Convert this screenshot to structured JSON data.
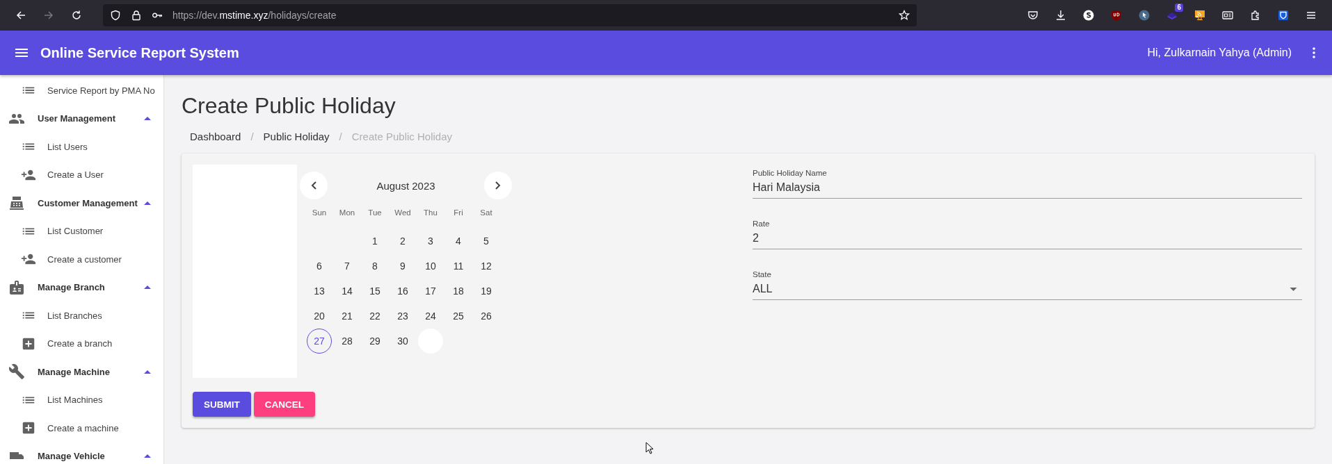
{
  "browser": {
    "url_prefix": "https://dev.",
    "url_domain": "mstime.xyz",
    "url_path": "/holidays/create",
    "extension_badge": "6",
    "forward_disabled": true
  },
  "app_bar": {
    "title": "Online Service Report System",
    "greeting": "Hi, Zulkarnain Yahya (Admin)"
  },
  "sidebar": {
    "items": [
      {
        "kind": "link",
        "label": "Service Report by PMA No"
      },
      {
        "kind": "group",
        "label": "User Management",
        "expanded": true
      },
      {
        "kind": "link",
        "label": "List Users"
      },
      {
        "kind": "link",
        "label": "Create a User"
      },
      {
        "kind": "group",
        "label": "Customer Management",
        "expanded": true
      },
      {
        "kind": "link",
        "label": "List Customer"
      },
      {
        "kind": "link",
        "label": "Create a customer"
      },
      {
        "kind": "group",
        "label": "Manage Branch",
        "expanded": true
      },
      {
        "kind": "link",
        "label": "List Branches"
      },
      {
        "kind": "link",
        "label": "Create a branch"
      },
      {
        "kind": "group",
        "label": "Manage Machine",
        "expanded": true
      },
      {
        "kind": "link",
        "label": "List Machines"
      },
      {
        "kind": "link",
        "label": "Create a machine"
      },
      {
        "kind": "group",
        "label": "Manage Vehicle",
        "expanded": true
      }
    ]
  },
  "page": {
    "title": "Create Public Holiday",
    "breadcrumb_separator": "/",
    "breadcrumbs": [
      {
        "label": "Dashboard",
        "disabled": false
      },
      {
        "label": "Public Holiday",
        "disabled": false
      },
      {
        "label": "Create Public Holiday",
        "disabled": true
      }
    ]
  },
  "calendar": {
    "month": "August 2023",
    "weekdays": [
      "Sun",
      "Mon",
      "Tue",
      "Wed",
      "Thu",
      "Fri",
      "Sat"
    ],
    "days": [
      {
        "kind": "empty"
      },
      {
        "kind": "empty"
      },
      {
        "kind": "day",
        "label": "1",
        "today": false
      },
      {
        "kind": "day",
        "label": "2",
        "today": false
      },
      {
        "kind": "day",
        "label": "3",
        "today": false
      },
      {
        "kind": "day",
        "label": "4",
        "today": false
      },
      {
        "kind": "day",
        "label": "5",
        "today": false
      },
      {
        "kind": "day",
        "label": "6",
        "today": false
      },
      {
        "kind": "day",
        "label": "7",
        "today": false
      },
      {
        "kind": "day",
        "label": "8",
        "today": false
      },
      {
        "kind": "day",
        "label": "9",
        "today": false
      },
      {
        "kind": "day",
        "label": "10",
        "today": false
      },
      {
        "kind": "day",
        "label": "11",
        "today": false
      },
      {
        "kind": "day",
        "label": "12",
        "today": false
      },
      {
        "kind": "day",
        "label": "13",
        "today": false
      },
      {
        "kind": "day",
        "label": "14",
        "today": false
      },
      {
        "kind": "day",
        "label": "15",
        "today": false
      },
      {
        "kind": "day",
        "label": "16",
        "today": false
      },
      {
        "kind": "day",
        "label": "17",
        "today": false
      },
      {
        "kind": "day",
        "label": "18",
        "today": false
      },
      {
        "kind": "day",
        "label": "19",
        "today": false
      },
      {
        "kind": "day",
        "label": "20",
        "today": false
      },
      {
        "kind": "day",
        "label": "21",
        "today": false
      },
      {
        "kind": "day",
        "label": "22",
        "today": false
      },
      {
        "kind": "day",
        "label": "23",
        "today": false
      },
      {
        "kind": "day",
        "label": "24",
        "today": false
      },
      {
        "kind": "day",
        "label": "25",
        "today": false
      },
      {
        "kind": "day",
        "label": "26",
        "today": false
      },
      {
        "kind": "day",
        "label": "27",
        "today": true
      },
      {
        "kind": "day",
        "label": "28",
        "today": false
      },
      {
        "kind": "day",
        "label": "29",
        "today": false
      },
      {
        "kind": "day",
        "label": "30",
        "today": false
      },
      {
        "kind": "blank"
      }
    ]
  },
  "form": {
    "fields": [
      {
        "kind": "text",
        "label": "Public Holiday Name",
        "value": "Hari Malaysia"
      },
      {
        "kind": "text",
        "label": "Rate",
        "value": "2"
      },
      {
        "kind": "select",
        "label": "State",
        "value": "ALL"
      }
    ]
  },
  "buttons": [
    {
      "kind": "primary",
      "label": "SUBMIT"
    },
    {
      "kind": "danger",
      "label": "CANCEL"
    }
  ]
}
